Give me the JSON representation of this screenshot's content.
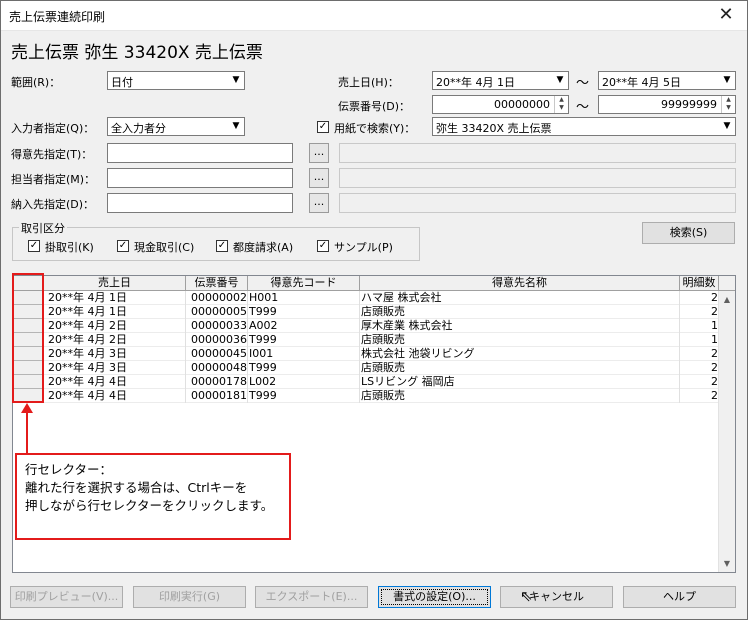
{
  "window": {
    "title": "売上伝票連続印刷",
    "close_glyph": "✕"
  },
  "heading": "売上伝票 弥生 33420X 売上伝票",
  "filters": {
    "range_label": "範囲(R)：",
    "range_value": "日付",
    "input_person_label": "入力者指定(Q)：",
    "input_person_value": "全入力者分",
    "customer_label": "得意先指定(T)：",
    "staff_label": "担当者指定(M)：",
    "delivery_label": "納入先指定(D)：",
    "browse_glyph": "...",
    "sales_date_label": "売上日(H)：",
    "date_from": "20**年 4月 1日",
    "date_to": "20**年 4月 5日",
    "tilde": "～",
    "slip_no_label": "伝票番号(D)：",
    "slip_from": "00000000",
    "slip_to": "99999999",
    "form_search_label": "用紙で検索(Y)：",
    "form_search_checked": "✓",
    "form_value": "弥生 33420X 売上伝票"
  },
  "transaction_group": {
    "legend": "取引区分",
    "options": [
      {
        "label": "掛取引(K)",
        "check": "✓"
      },
      {
        "label": "現金取引(C)",
        "check": "✓"
      },
      {
        "label": "都度請求(A)",
        "check": "✓"
      },
      {
        "label": "サンプル(P)",
        "check": "✓"
      }
    ]
  },
  "search_button": "検索(S)",
  "table": {
    "columns": [
      "売上日",
      "伝票番号",
      "得意先コード",
      "得意先名称",
      "明細数"
    ],
    "rows": [
      [
        "20**年 4月 1日",
        "00000002",
        "H001",
        "ハマ屋 株式会社",
        "2"
      ],
      [
        "20**年 4月 1日",
        "00000005",
        "T999",
        "店頭販売",
        "2"
      ],
      [
        "20**年 4月 2日",
        "00000033",
        "A002",
        "厚木産業 株式会社",
        "1"
      ],
      [
        "20**年 4月 2日",
        "00000036",
        "T999",
        "店頭販売",
        "1"
      ],
      [
        "20**年 4月 3日",
        "00000045",
        "I001",
        "株式会社 池袋リビング",
        "2"
      ],
      [
        "20**年 4月 3日",
        "00000048",
        "T999",
        "店頭販売",
        "2"
      ],
      [
        "20**年 4月 4日",
        "00000178",
        "L002",
        "LSリビング 福岡店",
        "2"
      ],
      [
        "20**年 4月 4日",
        "00000181",
        "T999",
        "店頭販売",
        "2"
      ]
    ]
  },
  "callout": {
    "line1": "行セレクター：",
    "line2": "離れた行を選択する場合は、Ctrlキーを",
    "line3": "押しながら行セレクターをクリックします。"
  },
  "buttons": {
    "preview": "印刷プレビュー(V)...",
    "print": "印刷実行(G)",
    "export": "エクスポート(E)...",
    "format": "書式の設定(O)...",
    "cancel": "キャンセル",
    "help": "ヘルプ"
  },
  "colors": {
    "highlight_red": "#e31b1b",
    "focus_blue": "#0078d7"
  }
}
